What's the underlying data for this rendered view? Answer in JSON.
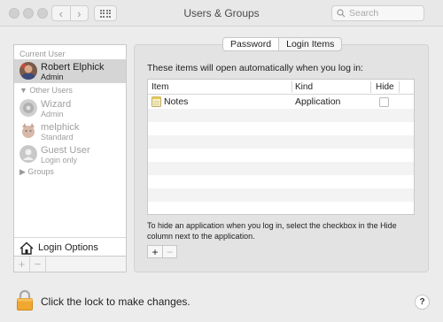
{
  "window": {
    "title": "Users & Groups"
  },
  "toolbar": {
    "back_label": "‹",
    "forward_label": "›",
    "search_placeholder": "Search"
  },
  "sidebar": {
    "current_user_header": "Current User",
    "current_user": {
      "name": "Robert Elphick",
      "role": "Admin"
    },
    "other_users_header": "Other Users",
    "other_users": [
      {
        "name": "Wizard",
        "role": "Admin"
      },
      {
        "name": "melphick",
        "role": "Standard"
      },
      {
        "name": "Guest User",
        "role": "Login only"
      }
    ],
    "groups_header": "Groups",
    "login_options_label": "Login Options",
    "add_label": "+",
    "remove_label": "−"
  },
  "tabs": [
    {
      "label": "Password",
      "active": true
    },
    {
      "label": "Login Items",
      "active": false
    }
  ],
  "login_items": {
    "intro": "These items will open automatically when you log in:",
    "columns": [
      "Item",
      "Kind",
      "Hide"
    ],
    "rows": [
      {
        "item": "Notes",
        "kind": "Application",
        "hide": false
      }
    ],
    "hint": "To hide an application when you log in, select the checkbox in the Hide column next to the application.",
    "add_label": "+",
    "remove_label": "−"
  },
  "footer": {
    "lock_text": "Click the lock to make changes.",
    "help_label": "?"
  }
}
